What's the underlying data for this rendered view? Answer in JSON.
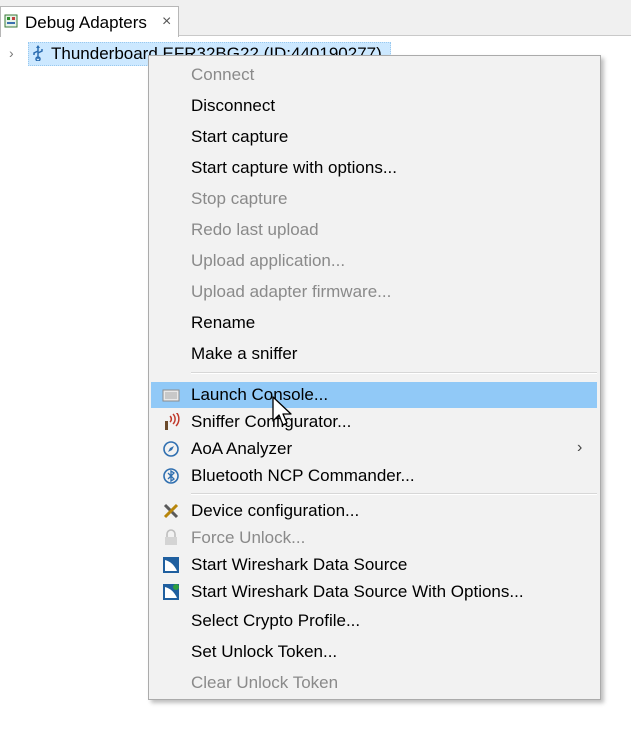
{
  "view": {
    "tab_title": "Debug Adapters",
    "tab_icon": "debug-adapters-icon",
    "close_glyph": "×"
  },
  "tree": {
    "chevron": "›",
    "adapter_label": "Thunderboard EFR32BG22 (ID:440190277)",
    "adapter_icon": "usb-icon"
  },
  "context_menu": {
    "items": [
      {
        "label": "Connect",
        "enabled": false
      },
      {
        "label": "Disconnect",
        "enabled": true
      },
      {
        "label": "Start capture",
        "enabled": true
      },
      {
        "label": "Start capture with options...",
        "enabled": true
      },
      {
        "label": "Stop capture",
        "enabled": false
      },
      {
        "label": "Redo last upload",
        "enabled": false
      },
      {
        "label": "Upload application...",
        "enabled": false
      },
      {
        "label": "Upload adapter firmware...",
        "enabled": false
      },
      {
        "label": "Rename",
        "enabled": true
      },
      {
        "label": "Make a sniffer",
        "enabled": true
      },
      {
        "label": "Launch Console...",
        "enabled": true,
        "highlighted": true,
        "icon": "console-icon"
      },
      {
        "label": "Sniffer Configurator...",
        "enabled": true,
        "icon": "sniffer-icon"
      },
      {
        "label": "AoA Analyzer",
        "enabled": true,
        "icon": "compass-icon",
        "submenu": true
      },
      {
        "label": "Bluetooth NCP Commander...",
        "enabled": true,
        "icon": "bluetooth-icon"
      },
      {
        "label": "Device configuration...",
        "enabled": true,
        "icon": "tools-icon"
      },
      {
        "label": "Force Unlock...",
        "enabled": false,
        "icon": "lock-icon"
      },
      {
        "label": "Start Wireshark Data Source",
        "enabled": true,
        "icon": "wireshark-icon"
      },
      {
        "label": "Start Wireshark Data Source With Options...",
        "enabled": true,
        "icon": "wireshark-options-icon"
      },
      {
        "label": "Select Crypto Profile...",
        "enabled": true
      },
      {
        "label": "Set Unlock Token...",
        "enabled": true
      },
      {
        "label": "Clear Unlock Token",
        "enabled": false
      }
    ],
    "submenu_glyph": "›"
  },
  "colors": {
    "selection": "#cce8ff",
    "menu_highlight": "#91c9f7",
    "menu_background": "#f2f2f2",
    "disabled_text": "#8a8a8a"
  }
}
